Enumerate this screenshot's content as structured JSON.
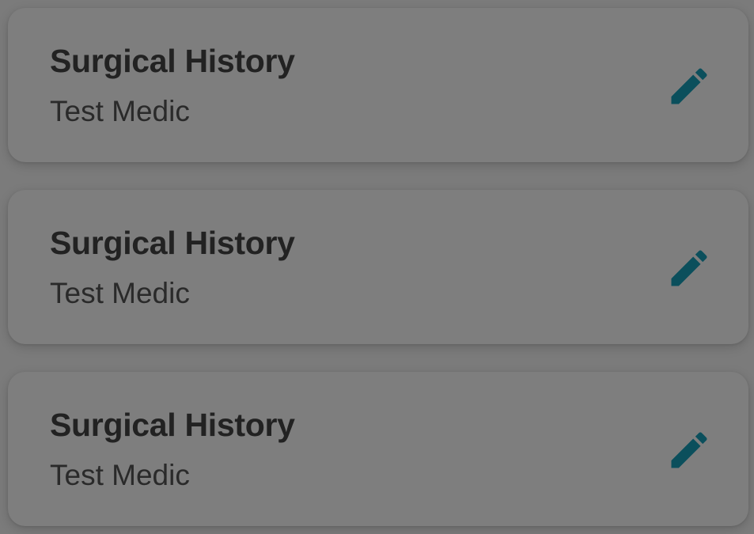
{
  "colors": {
    "background": "#7b7b7b",
    "card": "#7e7e7e",
    "title_text": "#222222",
    "subtitle_text": "#2a2a2a",
    "edit_icon": "#0b4f5c"
  },
  "cards": [
    {
      "title": "Surgical History",
      "subtitle": "Test Medic",
      "action_icon": "pencil-edit-icon"
    },
    {
      "title": "Surgical History",
      "subtitle": "Test Medic",
      "action_icon": "pencil-edit-icon"
    },
    {
      "title": "Surgical History",
      "subtitle": "Test Medic",
      "action_icon": "pencil-edit-icon"
    }
  ]
}
